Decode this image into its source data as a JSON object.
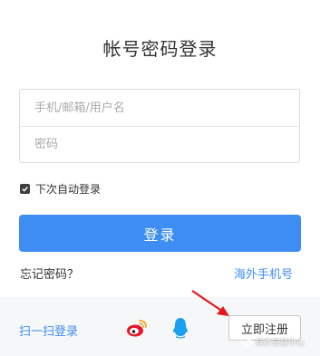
{
  "header": {
    "title": "帐号密码登录"
  },
  "form": {
    "username_placeholder": "手机/邮箱/用户名",
    "password_placeholder": "密码",
    "remember_label": "下次自动登录",
    "remember_checked": true,
    "login_label": "登录"
  },
  "links": {
    "forgot_password": "忘记密码？",
    "overseas_phone": "海外手机号"
  },
  "footer": {
    "scan_login": "扫一扫登录",
    "social_icons": [
      "weibo-icon",
      "qq-icon"
    ],
    "register_label": "立即注册"
  },
  "overlay": {
    "arrow": "red-arrow-icon",
    "watermark_text": "软件安装中心"
  },
  "colors": {
    "accent": "#3d8df2",
    "bottom_bar": "#f6f7f9",
    "weibo_red": "#e6162d",
    "weibo_orange": "#f5a623",
    "qq_blue": "#1aa0f0",
    "arrow_red": "#e5161c"
  }
}
